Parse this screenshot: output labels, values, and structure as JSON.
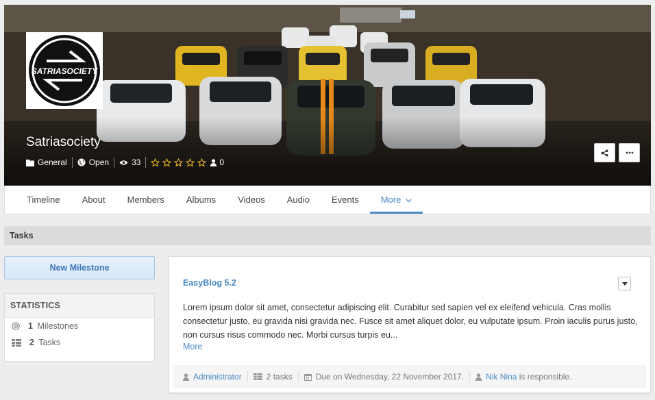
{
  "cover": {
    "title": "Satriasociety",
    "logo_text": "SATRIASOCIETY",
    "meta": {
      "category": "General",
      "privacy": "Open",
      "views": "33",
      "rating_count": "0"
    }
  },
  "nav": {
    "items": [
      "Timeline",
      "About",
      "Members",
      "Albums",
      "Videos",
      "Audio",
      "Events"
    ],
    "more_label": "More"
  },
  "section": {
    "title": "Tasks"
  },
  "sidebar": {
    "new_milestone_label": "New Milestone",
    "stats_title": "STATISTICS",
    "milestones_count": "1",
    "milestones_label": "Milestones",
    "tasks_count": "2",
    "tasks_label": "Tasks"
  },
  "task": {
    "title": "EasyBlog 5.2",
    "description": "Lorem ipsum dolor sit amet, consectetur adipiscing elit. Curabitur sed sapien vel ex eleifend vehicula. Cras mollis consectetur justo, eu gravida nisi gravida nec. Fusce sit amet aliquet dolor, eu vulputate ipsum. Proin iaculis purus justo, non cursus risus commodo nec. Morbi cursus turpis eu...",
    "more_label": "More",
    "footer": {
      "author": "Administrator",
      "tasks": "2 tasks",
      "due": "Due on Wednesday, 22 November 2017.",
      "responsible_name": "Nik Nina",
      "responsible_suffix": "is responsible."
    }
  }
}
